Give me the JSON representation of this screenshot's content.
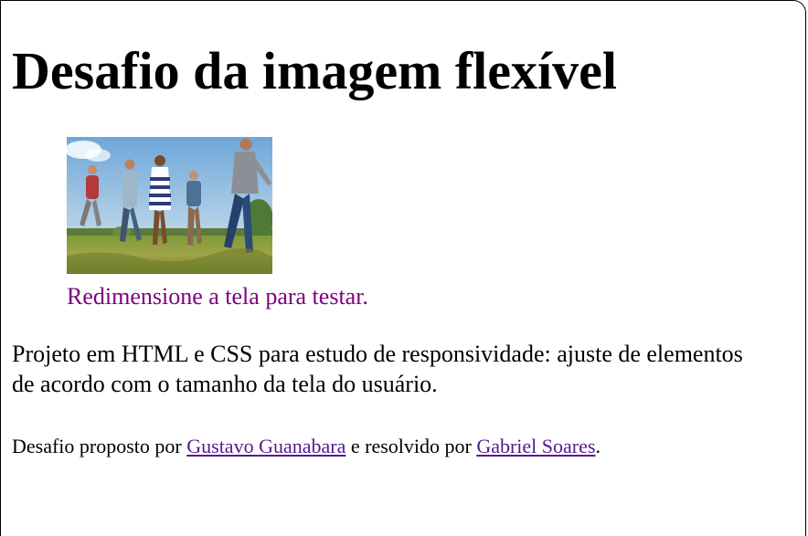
{
  "page": {
    "title": "Desafio da imagem flexível",
    "figure": {
      "alt": "Grupo de amigos correndo em um campo",
      "caption": "Redimensione a tela para testar."
    },
    "description": "Projeto em HTML e CSS para estudo de responsividade: ajuste de elementos de acordo com o tamanho da tela do usuário.",
    "credits": {
      "prefix": "Desafio proposto por",
      "author1": "Gustavo Guanabara",
      "middle": "e resolvido por",
      "author2": "Gabriel Soares",
      "suffix": "."
    }
  },
  "colors": {
    "caption": "#800080",
    "link_visited": "#551a8b"
  }
}
